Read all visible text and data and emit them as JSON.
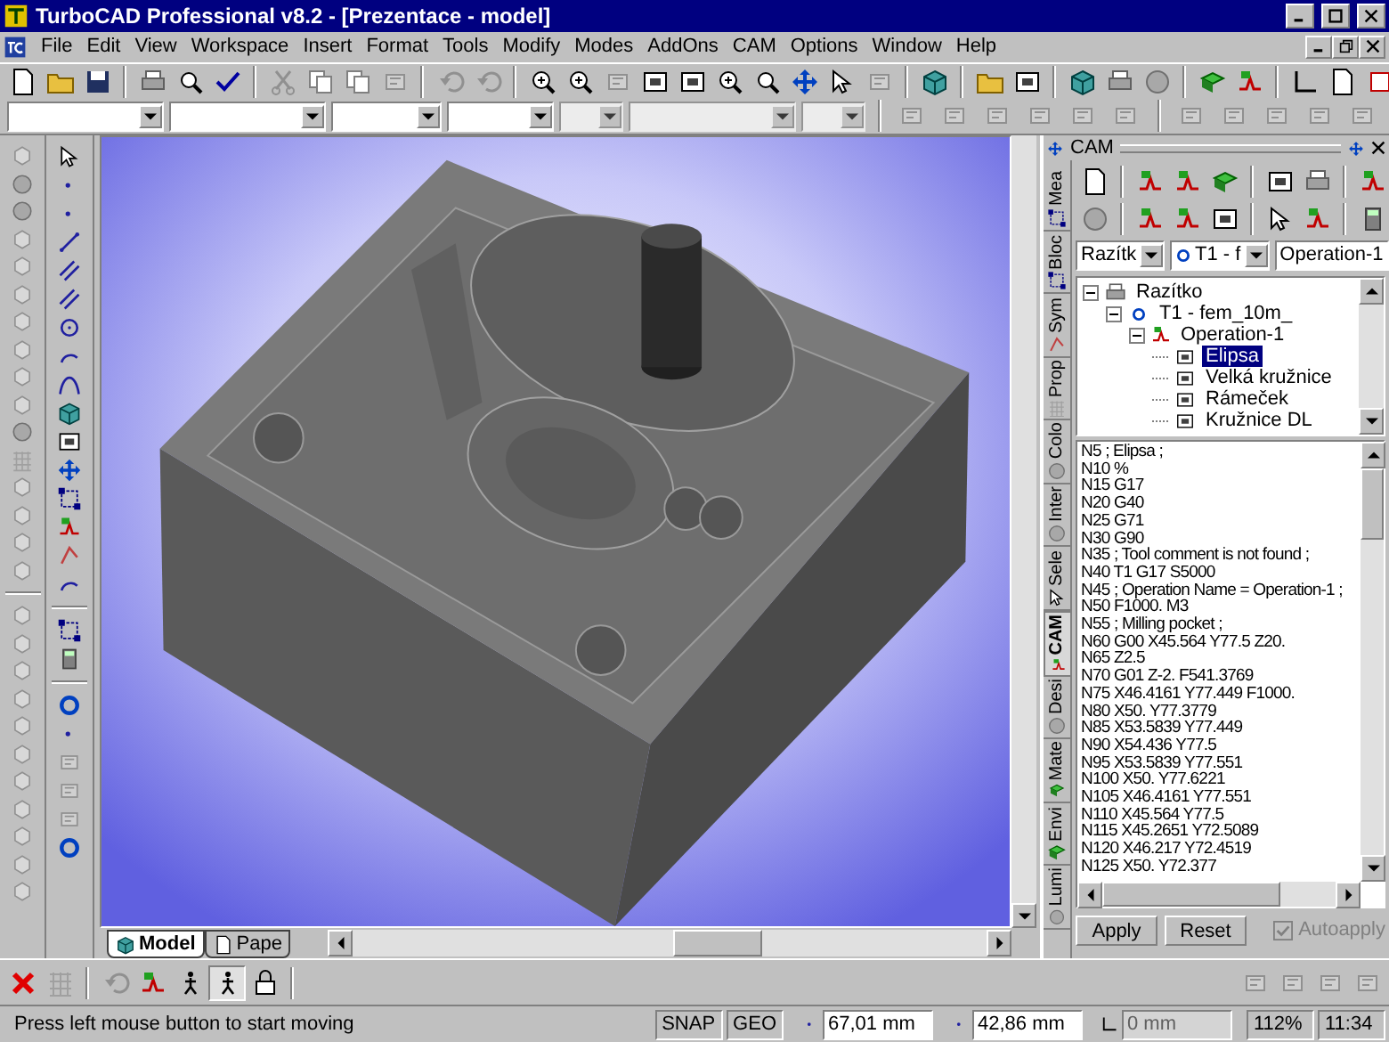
{
  "window": {
    "title": "TurboCAD Professional v8.2 - [Prezentace - model]"
  },
  "menu": [
    "File",
    "Edit",
    "View",
    "Workspace",
    "Insert",
    "Format",
    "Tools",
    "Modify",
    "Modes",
    "AddOns",
    "CAM",
    "Options",
    "Window",
    "Help"
  ],
  "document_tabs": [
    {
      "label": "Model",
      "selected": true
    },
    {
      "label": "Pape",
      "selected": false
    }
  ],
  "cam_panel": {
    "title": "CAM",
    "side_tabs": [
      {
        "label": "Mea",
        "selected": false
      },
      {
        "label": "Bloc",
        "selected": false
      },
      {
        "label": "Sym",
        "selected": false
      },
      {
        "label": "Prop",
        "selected": false
      },
      {
        "label": "Colo",
        "selected": false
      },
      {
        "label": "Inter",
        "selected": false
      },
      {
        "label": "Sele",
        "selected": false
      },
      {
        "label": "CAM",
        "selected": true
      },
      {
        "label": "Desi",
        "selected": false
      },
      {
        "label": "Mate",
        "selected": false
      },
      {
        "label": "Envi",
        "selected": false
      },
      {
        "label": "Lumi",
        "selected": false
      }
    ],
    "part_combo": "Razítk",
    "tool_combo": "T1 - f",
    "operation_field": "Operation-1",
    "tree": [
      {
        "kind": "part",
        "label": "Razítko",
        "expanded": true,
        "selected": false,
        "children": [
          {
            "kind": "tool",
            "label": "T1 - fem_10m_",
            "expanded": true,
            "selected": false,
            "children": [
              {
                "kind": "operation",
                "label": "Operation-1",
                "expanded": true,
                "selected": false,
                "children": [
                  {
                    "kind": "contour",
                    "label": "Elipsa",
                    "selected": true
                  },
                  {
                    "kind": "contour",
                    "label": "Velká kružnice",
                    "selected": false
                  },
                  {
                    "kind": "contour",
                    "label": "Rámeček",
                    "selected": false
                  },
                  {
                    "kind": "contour",
                    "label": "Kružnice DL",
                    "selected": false
                  }
                ]
              }
            ]
          }
        ]
      }
    ],
    "gcode": [
      "N5 ; Elipsa ;",
      "N10 %",
      "N15 G17",
      "N20 G40",
      "N25 G71",
      "N30 G90",
      "N35 ; Tool comment is not found ;",
      "N40 T1 G17 S5000",
      "N45 ; Operation Name = Operation-1 ;",
      "N50 F1000. M3",
      "N55 ; Milling pocket ;",
      "N60 G00 X45.564 Y77.5 Z20.",
      "N65 Z2.5",
      "N70 G01 Z-2. F541.3769",
      "N75 X46.4161 Y77.449 F1000.",
      "N80 X50. Y77.3779",
      "N85 X53.5839 Y77.449",
      "N90 X54.436 Y77.5",
      "N95 X53.5839 Y77.551",
      "N100 X50. Y77.6221",
      "N105 X46.4161 Y77.551",
      "N110 X45.564 Y77.5",
      "N115 X45.2651 Y72.5089",
      "N120 X46.217 Y72.4519",
      "N125 X50. Y72.377"
    ],
    "buttons": [
      "Apply",
      "Reset"
    ],
    "autoapply": {
      "label": "Autoapply",
      "checked": true,
      "disabled": true
    }
  },
  "status_bar": {
    "message": "Press left mouse button to start moving",
    "toggles": [
      "SNAP",
      "GEO"
    ],
    "coordinates": [
      {
        "value": "67,01 mm",
        "disabled": false
      },
      {
        "value": "42,86 mm",
        "disabled": false
      },
      {
        "value": "0 mm",
        "disabled": true
      }
    ],
    "zoom": "112%",
    "time": "11:34"
  }
}
